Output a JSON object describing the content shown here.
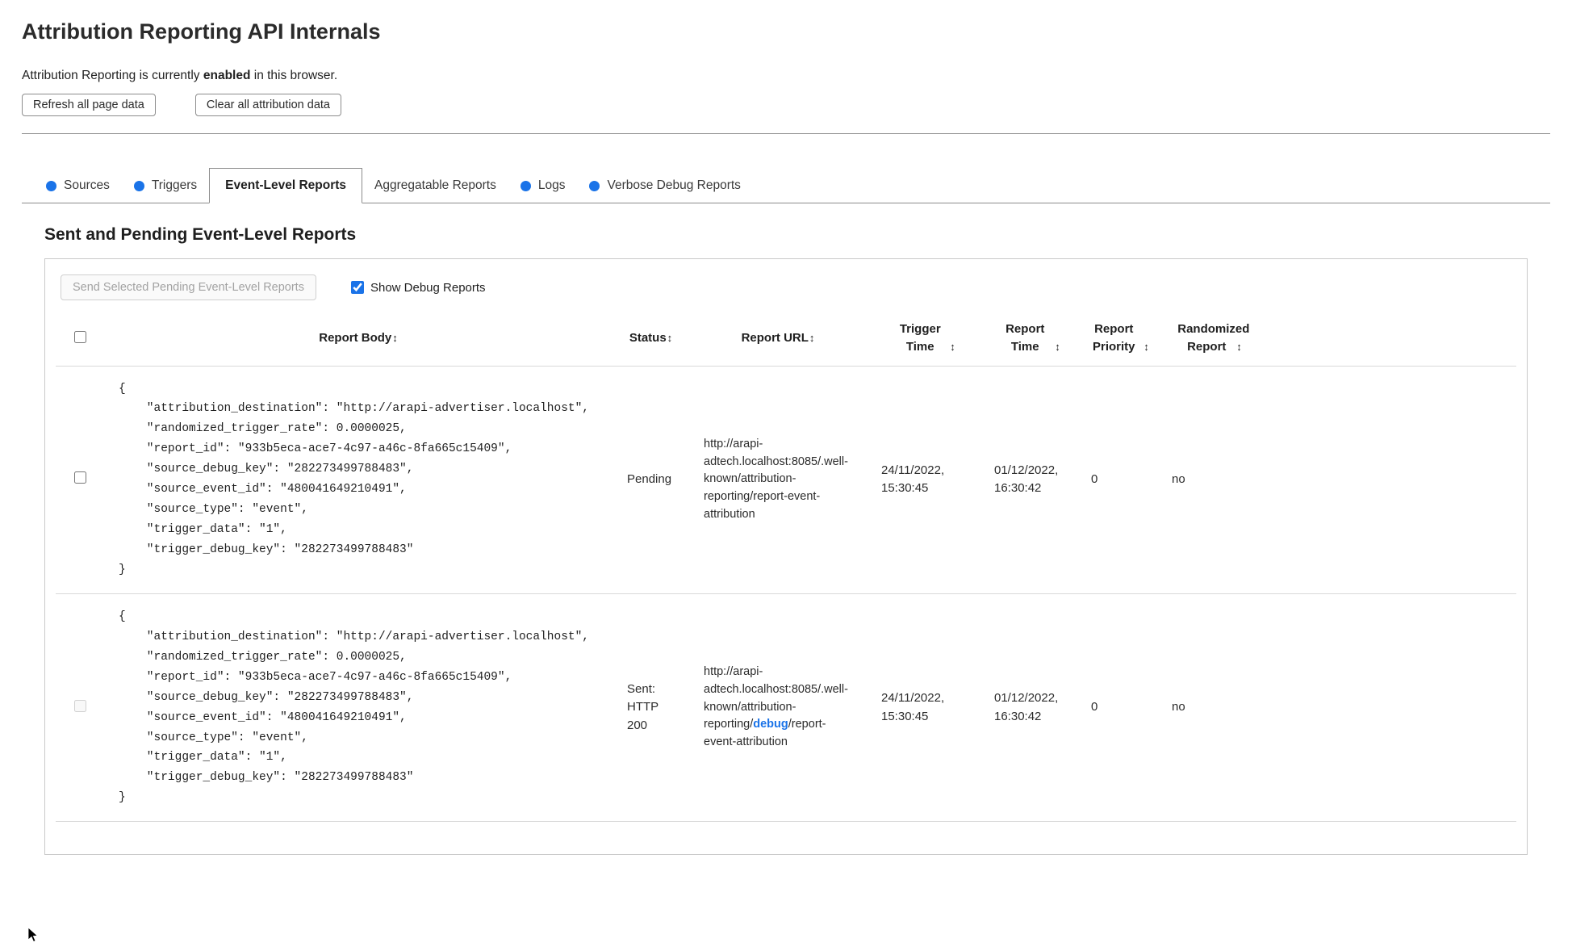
{
  "page": {
    "title": "Attribution Reporting API Internals",
    "status_prefix": "Attribution Reporting is currently ",
    "status_bold": "enabled",
    "status_suffix": " in this browser.",
    "refresh_button": "Refresh all page data",
    "clear_button": "Clear all attribution data"
  },
  "tabs": [
    {
      "label": "Sources",
      "has_new_data_dot": true,
      "active": false
    },
    {
      "label": "Triggers",
      "has_new_data_dot": true,
      "active": false
    },
    {
      "label": "Event-Level Reports",
      "has_new_data_dot": false,
      "active": true
    },
    {
      "label": "Aggregatable Reports",
      "has_new_data_dot": false,
      "active": false
    },
    {
      "label": "Logs",
      "has_new_data_dot": true,
      "active": false
    },
    {
      "label": "Verbose Debug Reports",
      "has_new_data_dot": true,
      "active": false
    }
  ],
  "colors": {
    "accent_blue": "#1a73e8"
  },
  "section": {
    "heading": "Sent and Pending Event-Level Reports",
    "send_button": "Send Selected Pending Event-Level Reports",
    "show_debug_label": "Show Debug Reports",
    "show_debug_checked": true
  },
  "table": {
    "sort_glyph": "↕",
    "headers": [
      "Report Body",
      "Status",
      "Report URL",
      "Trigger Time",
      "Report Time",
      "Report Priority",
      "Randomized Report"
    ],
    "rows": [
      {
        "selectable": true,
        "report_body": "{\n    \"attribution_destination\": \"http://arapi-advertiser.localhost\",\n    \"randomized_trigger_rate\": 0.0000025,\n    \"report_id\": \"933b5eca-ace7-4c97-a46c-8fa665c15409\",\n    \"source_debug_key\": \"282273499788483\",\n    \"source_event_id\": \"480041649210491\",\n    \"source_type\": \"event\",\n    \"trigger_data\": \"1\",\n    \"trigger_debug_key\": \"282273499788483\"\n}",
        "status": "Pending",
        "url_prefix": "http://arapi-adtech.localhost:8085/.well-known/attribution-reporting/report-event-attribution",
        "url_highlight": "",
        "url_suffix": "",
        "trigger_time": "24/11/2022, 15:30:45",
        "report_time": "01/12/2022, 16:30:42",
        "report_priority": "0",
        "randomized_report": "no"
      },
      {
        "selectable": false,
        "report_body": "{\n    \"attribution_destination\": \"http://arapi-advertiser.localhost\",\n    \"randomized_trigger_rate\": 0.0000025,\n    \"report_id\": \"933b5eca-ace7-4c97-a46c-8fa665c15409\",\n    \"source_debug_key\": \"282273499788483\",\n    \"source_event_id\": \"480041649210491\",\n    \"source_type\": \"event\",\n    \"trigger_data\": \"1\",\n    \"trigger_debug_key\": \"282273499788483\"\n}",
        "status": "Sent: HTTP 200",
        "url_prefix": "http://arapi-adtech.localhost:8085/.well-known/attribution-reporting/",
        "url_highlight": "debug",
        "url_suffix": "/report-event-attribution",
        "trigger_time": "24/11/2022, 15:30:45",
        "report_time": "01/12/2022, 16:30:42",
        "report_priority": "0",
        "randomized_report": "no"
      }
    ]
  }
}
